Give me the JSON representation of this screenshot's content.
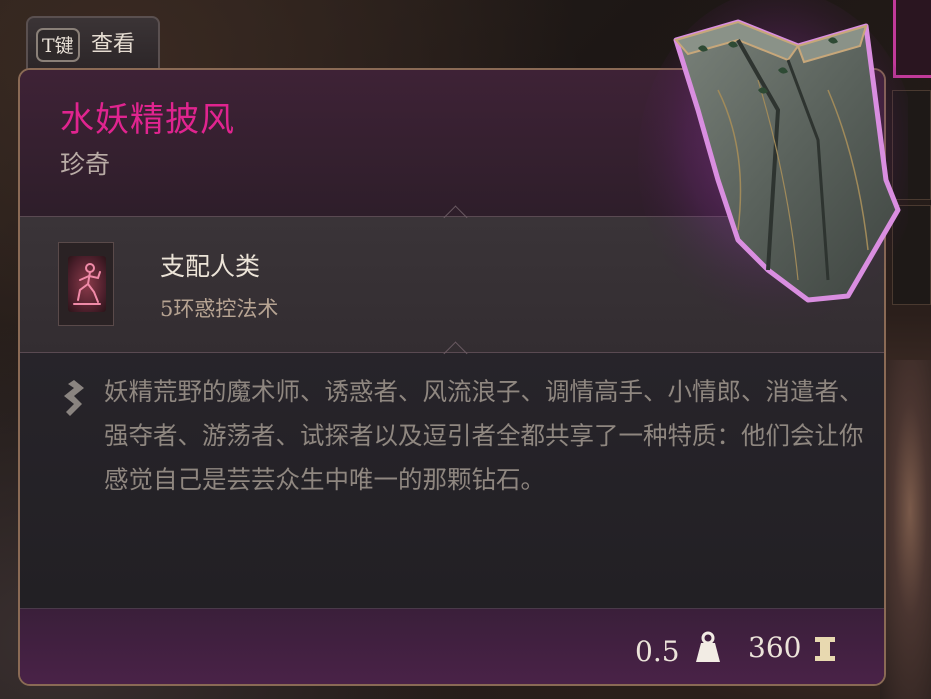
{
  "hint": {
    "key": "T键",
    "label": "查看"
  },
  "item": {
    "name": "水妖精披风",
    "rarity": "珍奇",
    "icon": "cloak-icon",
    "rarity_color": "#e0248f"
  },
  "spell": {
    "name": "支配人类",
    "subtitle": "5环惑控法术",
    "icon": "dominate-person-icon"
  },
  "description": {
    "text": "妖精荒野的魔术师、诱惑者、风流浪子、调情高手、小情郎、消遣者、强夺者、游荡者、试探者以及逗引者全都共享了一种特质：他们会让你感觉自己是芸芸众生中唯一的那颗钻石。",
    "icon": "quote-icon"
  },
  "footer": {
    "weight": "0.5",
    "weight_icon": "weight-icon",
    "value": "360",
    "value_icon": "gold-icon"
  }
}
